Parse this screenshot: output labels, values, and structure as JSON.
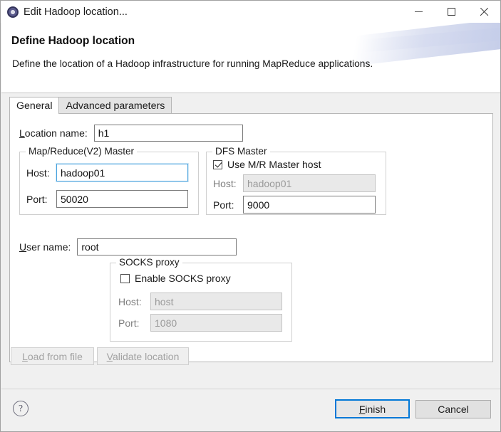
{
  "window": {
    "title": "Edit Hadoop location...",
    "icon": "hadoop-elephant-icon",
    "controls": {
      "minimize": "minimize-icon",
      "maximize": "maximize-icon",
      "close": "close-icon"
    }
  },
  "banner": {
    "title": "Define Hadoop location",
    "description": "Define the location of a Hadoop infrastructure for running MapReduce applications."
  },
  "tabs": [
    {
      "label": "General",
      "active": true
    },
    {
      "label": "Advanced parameters",
      "active": false
    }
  ],
  "general": {
    "location_name": {
      "label": "Location name:",
      "mnemonic": "L",
      "value": "h1",
      "placeholder": ""
    },
    "mapreduce_master": {
      "group_title": "Map/Reduce(V2) Master",
      "host": {
        "label": "Host:",
        "value": "hadoop01",
        "focused": true,
        "disabled": false
      },
      "port": {
        "label": "Port:",
        "value": "50020",
        "focused": false,
        "disabled": false
      }
    },
    "dfs_master": {
      "group_title": "DFS Master",
      "use_mr_master_host": {
        "label": "Use M/R Master host",
        "checked": true
      },
      "host": {
        "label": "Host:",
        "value": "hadoop01",
        "focused": false,
        "disabled": true
      },
      "port": {
        "label": "Port:",
        "value": "9000",
        "focused": false,
        "disabled": false
      }
    },
    "user_name": {
      "label": "User name:",
      "mnemonic": "U",
      "value": "root"
    },
    "socks_proxy": {
      "group_title": "SOCKS proxy",
      "enable": {
        "label": "Enable SOCKS proxy",
        "checked": false
      },
      "host": {
        "label": "Host:",
        "value": "host",
        "disabled": true
      },
      "port": {
        "label": "Port:",
        "value": "1080",
        "disabled": true
      }
    },
    "actions": {
      "load_from_file": {
        "label": "Load from file",
        "mnemonic": "L",
        "disabled": true
      },
      "validate_location": {
        "label": "Validate location",
        "mnemonic": "V",
        "disabled": true
      }
    }
  },
  "footer": {
    "help": "?",
    "finish": {
      "label": "Finish",
      "mnemonic": "F",
      "default": true
    },
    "cancel": {
      "label": "Cancel"
    }
  },
  "colors": {
    "accent": "#0078d7",
    "focus_border": "#4aa3df",
    "window_bg": "#f0f0f0",
    "panel_bg": "#ffffff",
    "disabled_text": "#9a9a9a"
  }
}
